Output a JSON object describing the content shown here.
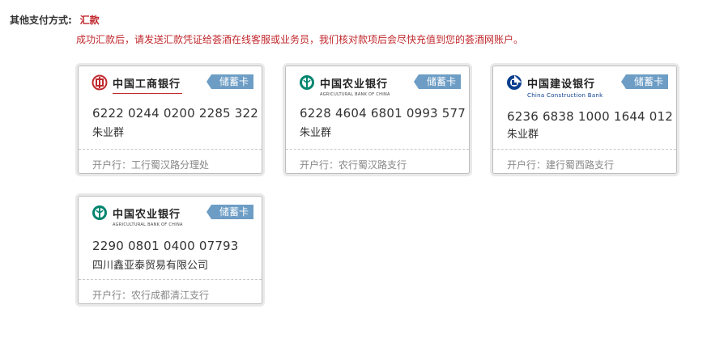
{
  "payment": {
    "label": "其他支付方式:",
    "method": "汇款",
    "notice": "成功汇款后，请发送汇款凭证给荟酒在线客服或业务员，我们核对款项后会尽快充值到您的荟酒网账户。"
  },
  "cards": [
    {
      "bank_name": "中国工商银行",
      "bank_en": "",
      "badge": "储蓄卡",
      "number": "6222 0244 0200 2285 322",
      "holder": "朱业群",
      "branch": "开户行：工行蜀汉路分理处",
      "brand_color": "#c0282d",
      "icon": "icbc-logo-icon"
    },
    {
      "bank_name": "中国农业银行",
      "bank_en": "AGRICULTURAL BANK OF CHINA",
      "badge": "储蓄卡",
      "number": "6228 4604 6801 0993 577",
      "holder": "朱业群",
      "branch": "开户行：农行蜀汉路支行",
      "brand_color": "#00856f",
      "icon": "abc-logo-icon"
    },
    {
      "bank_name": "中国建设银行",
      "bank_en": "China Construction Bank",
      "badge": "储蓄卡",
      "number": "6236 6838 1000 1644 012",
      "holder": "朱业群",
      "branch": "开户行：建行蜀西路支行",
      "brand_color": "#0b3f8f",
      "icon": "ccb-logo-icon"
    },
    {
      "bank_name": "中国农业银行",
      "bank_en": "AGRICULTURAL BANK OF CHINA",
      "badge": "储蓄卡",
      "number": "2290 0801 0400 07793",
      "holder": "四川鑫亚泰贸易有限公司",
      "branch": "开户行：农行成都清江支行",
      "brand_color": "#00856f",
      "icon": "abc-logo-icon"
    }
  ]
}
